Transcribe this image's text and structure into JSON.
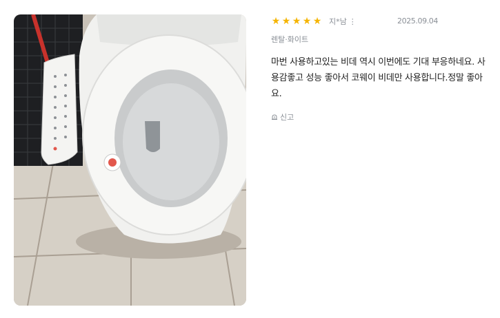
{
  "review": {
    "stars": [
      "★",
      "★",
      "★",
      "★",
      "★"
    ],
    "author": "지*남",
    "more_symbol": "⋮",
    "date": "2025.09.04",
    "option": "렌탈·화이트",
    "text": "마번 사용하고있는 비데 역시 이번에도 기대 부응하네요. 사용감좋고 성능 좋아서 코웨이 비데만 사용합니다.정말 좋아요.",
    "report_label": "신고"
  },
  "colors": {
    "star": "#f5b400",
    "meta_text": "#8a8f96",
    "body_text": "#222222"
  }
}
